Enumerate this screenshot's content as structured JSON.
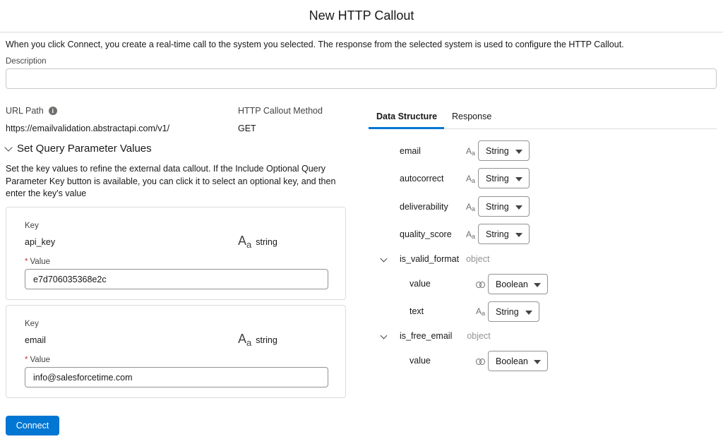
{
  "header": {
    "title": "New HTTP Callout"
  },
  "intro_text": "When you click Connect, you create a real-time call to the system you selected. The response from the selected system is used to configure the HTTP Callout.",
  "description": {
    "label": "Description",
    "value": ""
  },
  "url_path": {
    "label": "URL Path",
    "value": "https://emailvalidation.abstractapi.com/v1/",
    "info_icon": "i"
  },
  "method": {
    "label": "HTTP Callout Method",
    "value": "GET"
  },
  "query_section": {
    "title": "Set Query Parameter Values",
    "help": "Set the key values to refine the external data callout. If the Include Optional Query Parameter Key button is available, you can click it to select an optional key, and then enter the key's value"
  },
  "params": [
    {
      "key_label": "Key",
      "key": "api_key",
      "type_icon": "Aa",
      "type": "string",
      "required_marker": "*",
      "value_label": "Value",
      "value": "e7d706035368e2c"
    },
    {
      "key_label": "Key",
      "key": "email",
      "type_icon": "Aa",
      "type": "string",
      "required_marker": "*",
      "value_label": "Value",
      "value": "info@salesforcetime.com"
    }
  ],
  "connect_label": "Connect",
  "tabs": {
    "data_structure": "Data Structure",
    "response": "Response"
  },
  "structure": {
    "email": {
      "name": "email",
      "icon": "Aa",
      "type": "String"
    },
    "autocorrect": {
      "name": "autocorrect",
      "icon": "Aa",
      "type": "String"
    },
    "deliverability": {
      "name": "deliverability",
      "icon": "Aa",
      "type": "String"
    },
    "quality_score": {
      "name": "quality_score",
      "icon": "Aa",
      "type": "String"
    },
    "is_valid_format": {
      "name": "is_valid_format",
      "tag": "object"
    },
    "ivf_value": {
      "name": "value",
      "icon": "link",
      "type": "Boolean"
    },
    "ivf_text": {
      "name": "text",
      "icon": "Aa",
      "type": "String"
    },
    "is_free_email": {
      "name": "is_free_email",
      "tag": "object"
    },
    "ife_value": {
      "name": "value",
      "icon": "link",
      "type": "Boolean"
    }
  },
  "colors": {
    "brand": "#0176d3",
    "border": "#dddbda",
    "required": "#c23934"
  },
  "icons": {
    "info": "info-icon",
    "text_type": "text-type-icon",
    "boolean_type": "link-icon",
    "chevron": "chevron-down-icon",
    "caret": "caret-down-icon"
  }
}
